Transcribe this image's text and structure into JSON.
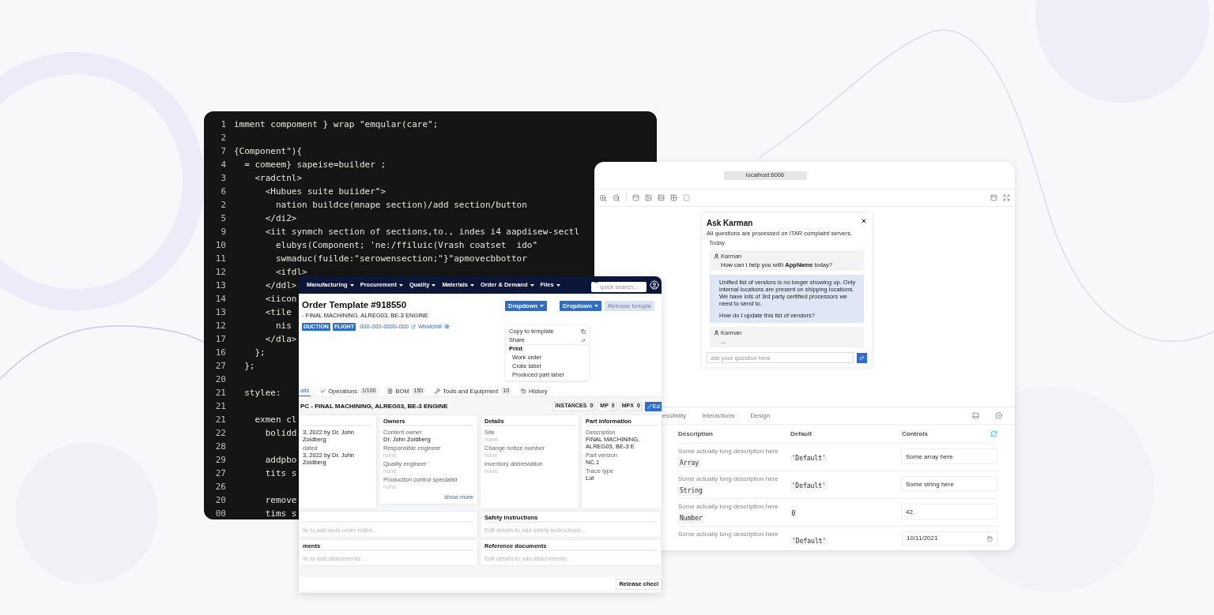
{
  "code_editor": {
    "lines": [
      {
        "number": "1",
        "text": "imment compoment } wrap \"emqular(care\";"
      },
      {
        "number": "2"
      },
      {
        "number": "7",
        "text": "{Component\"){"
      },
      {
        "number": "4",
        "text": "  = comeem} sapeise=builder ;"
      },
      {
        "number": "3",
        "text": "    <radctnl>"
      },
      {
        "number": "6",
        "text": "      <Hubues suite buiider\">"
      },
      {
        "number": "2",
        "text": "        nation buildce(mnape section)/add section/button"
      },
      {
        "number": "5",
        "text": "      </di2>"
      },
      {
        "number": "9",
        "text": "      <iit synmch section of sections,to., indes i4 aapdisew-sectl"
      },
      {
        "number": "10",
        "text": "        elubys(Component; 'ne:/ffiluic(Vrash coatset  ido\""
      },
      {
        "number": "11",
        "text": "        swmaduc(fuilde:\"serowensection;\"}\"apmovecbbottor"
      },
      {
        "number": "12",
        "text": "        <ifdl>"
      },
      {
        "number": "13",
        "text": "      </ddl>"
      },
      {
        "number": "14",
        "text": "      <iicon"
      },
      {
        "number": "13",
        "text": "      <tile"
      },
      {
        "number": "12",
        "text": "        nis"
      },
      {
        "number": "17",
        "text": "      </dla>"
      },
      {
        "number": "16",
        "text": "    };"
      },
      {
        "number": "27",
        "text": "  };"
      },
      {
        "number": "20"
      },
      {
        "number": "21",
        "text": "  stylee:"
      },
      {
        "number": "21"
      },
      {
        "number": "21",
        "text": "    exmen cl"
      },
      {
        "number": "22",
        "text": "      bolidd"
      },
      {
        "number": "28"
      },
      {
        "number": "29",
        "text": "      addpbo"
      },
      {
        "number": "27",
        "text": "      tits s"
      },
      {
        "number": "26"
      },
      {
        "number": "20",
        "text": "      remove"
      },
      {
        "number": "00",
        "text": "      tims s"
      }
    ]
  },
  "app_window": {
    "nav": {
      "menus": [
        "Manufacturing",
        "Procurement",
        "Quality",
        "Materials",
        "Order & Demand",
        "Files"
      ],
      "search": {
        "placeholder": "quick search..."
      }
    },
    "title": "Order Template #918550",
    "subtitle": "- FINAL MACHINING, ALREG03, BE-3 ENGINE",
    "badges": [
      "DUCTION",
      "FLIGHT"
    ],
    "part_number": "000-000-0000-000",
    "link": "Windchill",
    "buttons": [
      {
        "label": "Dropdown",
        "disabled": false
      },
      {
        "label": "Dropdown",
        "disabled": false
      },
      {
        "label": "Release templa",
        "disabled": true
      }
    ],
    "menu": [
      {
        "kind": "item",
        "label": "Copy to template"
      },
      {
        "kind": "item",
        "label": "Share"
      },
      {
        "kind": "header",
        "label": "Print"
      },
      {
        "kind": "subitem",
        "label": "Work order"
      },
      {
        "kind": "subitem",
        "label": "Crate label"
      },
      {
        "kind": "subitem",
        "label": "Produced part label"
      }
    ],
    "tabs": [
      {
        "label": "ails",
        "selected": true
      },
      {
        "label": "Operations",
        "count": "1/100",
        "selected": false
      },
      {
        "label": "BOM",
        "count": "150",
        "selected": false
      },
      {
        "label": "Tools and Equipment",
        "count": "10",
        "selected": false
      },
      {
        "label": "History",
        "selected": false
      }
    ],
    "heading": "PC - FINAL MACHINING, ALREG03, BE-3 ENGINE",
    "counters": [
      {
        "label": "INSTANCES",
        "value": "0"
      },
      {
        "label": "MP",
        "value": "0"
      },
      {
        "label": "MPX",
        "value": "0"
      }
    ],
    "edit_button": "Ed",
    "cards": [
      {
        "fields": [
          {
            "value": "3, 2022 by Dr. John Zoidberg",
            "empty": false
          },
          {
            "label": "dated",
            "value": "3, 2022 by Dr. John Zoidberg",
            "empty": false
          }
        ]
      },
      {
        "title": "Owners",
        "fields": [
          {
            "label": "Content owner",
            "value": "Dr. John Zoidberg",
            "empty": false
          },
          {
            "label": "Responsible engineer",
            "value": "none",
            "empty": true
          },
          {
            "label": "Quality engineer",
            "value": "none",
            "empty": true
          },
          {
            "label": "Produciton control specialist",
            "value": "none",
            "empty": true
          }
        ],
        "more": "show more"
      },
      {
        "title": "Details",
        "fields": [
          {
            "label": "Site",
            "value": "none",
            "empty": true
          },
          {
            "label": "Change notice number",
            "value": "none",
            "empty": true
          },
          {
            "label": "Inventory abbreviation",
            "value": "none",
            "empty": true
          }
        ]
      },
      {
        "title": "Part information",
        "fields": [
          {
            "label": "Description",
            "value": "FINAL MACHINING, ALREG03, BE-3 E",
            "empty": false
          },
          {
            "label": "Part version",
            "value": "NC.1",
            "empty": false
          },
          {
            "label": "Trace type",
            "value": "Lot",
            "empty": false
          }
        ]
      }
    ],
    "notes_columns": [
      [
        {
          "hint": "ils to add work order notes..."
        },
        {
          "title": "ments",
          "hint": "ils to add attachments..."
        }
      ],
      [
        {
          "title": "Safety instructions",
          "hint": "Edit details to add safety instructions..."
        },
        {
          "title": "Reference documents",
          "hint": "Edit details to add attachments..."
        }
      ]
    ],
    "release_button": "Release checl"
  },
  "storybook": {
    "address": "localhost:6006",
    "dialog": {
      "title": "Ask Karman",
      "subtitle": "All questions are processed on ITAR complaint servers.",
      "day": "Today",
      "messages": [
        {
          "kind": "bot",
          "sender": "Karman",
          "text": "How can I help you with **AppName** today?"
        },
        {
          "kind": "user",
          "paragraphs": [
            "Unified list of vendors is no longer showing up. Only internal locations are present on shipping locations. We have lots of 3rd party certified processors we need to send to.",
            "How do I update this list of vendors?"
          ]
        },
        {
          "kind": "bot",
          "sender": "Karman",
          "text": "..."
        }
      ],
      "input": {
        "placeholder": "ask your question here"
      }
    },
    "panel_tabs": [
      {
        "label": "essibility",
        "selected": false
      },
      {
        "label": "Interactions",
        "selected": false
      },
      {
        "label": "Design",
        "selected": false
      }
    ],
    "table": {
      "columns": [
        "Description",
        "Default",
        "Controls"
      ],
      "rows": [
        {
          "description": "Some actually long description here",
          "type": "Array",
          "default": "'Default'",
          "control": {
            "kind": "text",
            "value": "Some array here"
          }
        },
        {
          "description": "Some actually long description here",
          "type": "String",
          "default": "'Default'",
          "control": {
            "kind": "text",
            "value": "Some string here"
          }
        },
        {
          "description": "Some actually long description here",
          "type": "Number",
          "default": "0",
          "control": {
            "kind": "text",
            "value": "42"
          }
        },
        {
          "description": "Some actually long description here",
          "default": "'Default'",
          "control": {
            "kind": "date",
            "value": "10/11/2021"
          }
        }
      ]
    }
  }
}
